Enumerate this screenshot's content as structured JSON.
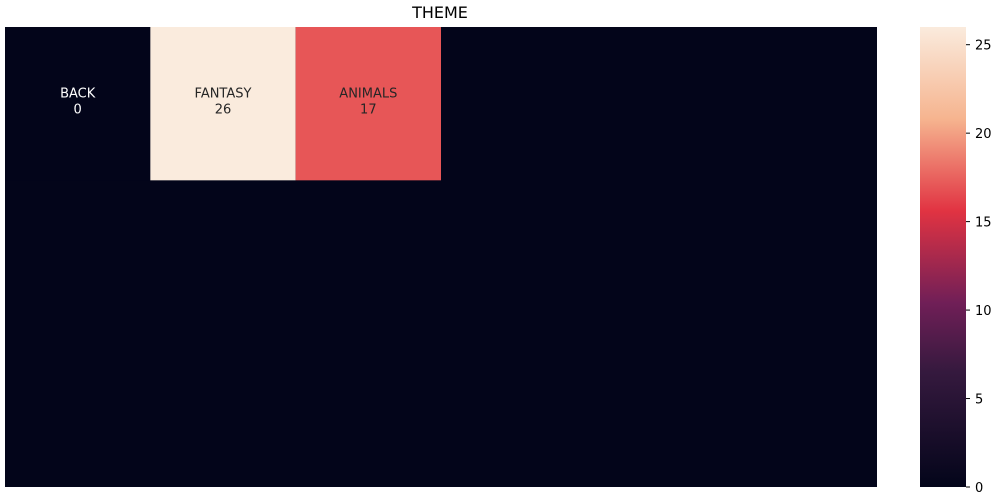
{
  "chart_data": {
    "type": "heatmap",
    "title": "THEME",
    "rows": 3,
    "cols": 6,
    "cells": [
      {
        "row": 0,
        "col": 0,
        "label": "BACK",
        "value": 0
      },
      {
        "row": 0,
        "col": 1,
        "label": "FANTASY",
        "value": 26
      },
      {
        "row": 0,
        "col": 2,
        "label": "ANIMALS",
        "value": 17
      }
    ],
    "colorbar": {
      "min": 0,
      "max": 26,
      "ticks": [
        0,
        5,
        10,
        15,
        20,
        25
      ]
    },
    "colormap": "rocket",
    "colors": {
      "zero": "#03051a",
      "low_mid": "#701f57",
      "mid": "#e13342",
      "high_mid": "#f6b48f",
      "max": "#faebdd"
    }
  }
}
